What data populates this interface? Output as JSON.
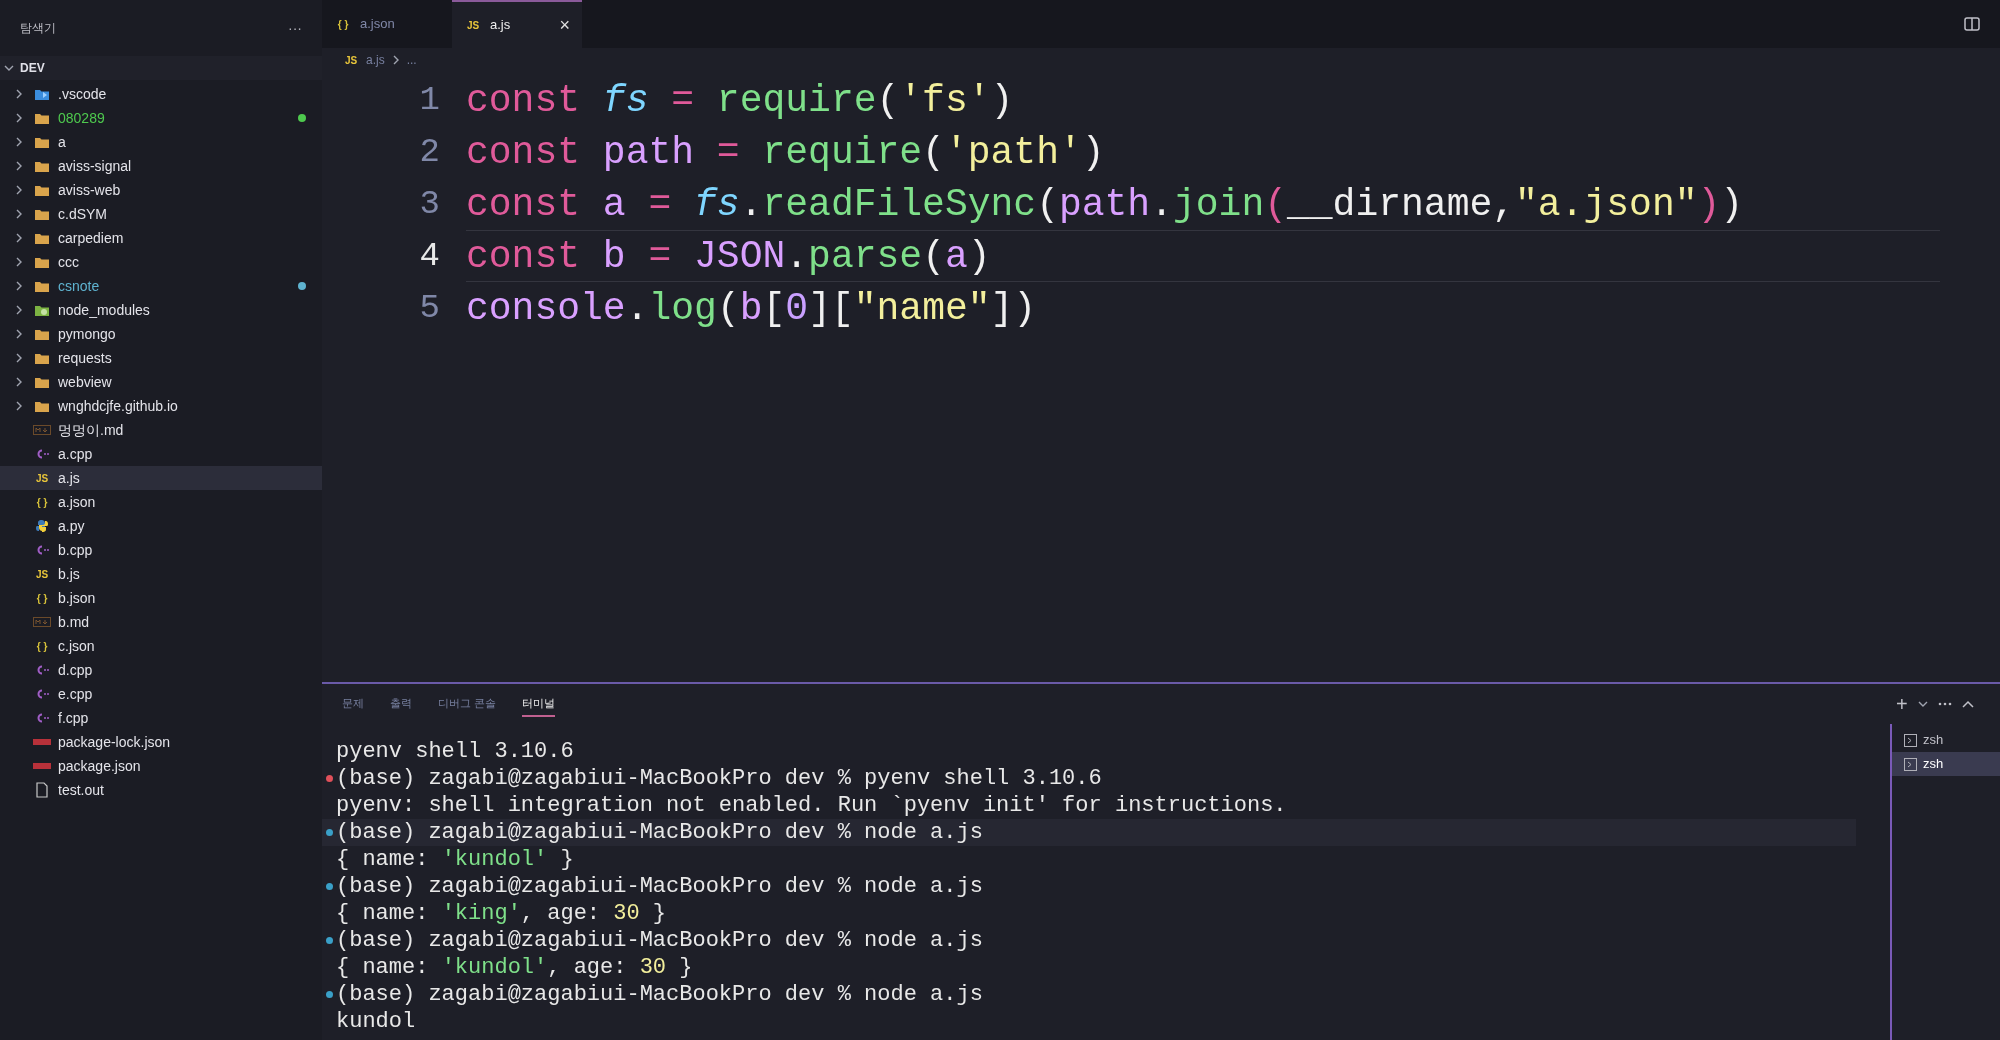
{
  "sidebar": {
    "title": "탐색기",
    "more": "···",
    "root": "DEV",
    "items": [
      {
        "name": ".vscode",
        "kind": "configfolder"
      },
      {
        "name": "080289",
        "kind": "folder",
        "color": "#4ec94e"
      },
      {
        "name": "a",
        "kind": "folder"
      },
      {
        "name": "aviss-signal",
        "kind": "folder"
      },
      {
        "name": "aviss-web",
        "kind": "folder"
      },
      {
        "name": "c.dSYM",
        "kind": "folder"
      },
      {
        "name": "carpediem",
        "kind": "folder"
      },
      {
        "name": "ccc",
        "kind": "folder"
      },
      {
        "name": "csnote",
        "kind": "folder",
        "color": "#5fb3d0"
      },
      {
        "name": "node_modules",
        "kind": "nodefolder"
      },
      {
        "name": "pymongo",
        "kind": "folder"
      },
      {
        "name": "requests",
        "kind": "folder"
      },
      {
        "name": "webview",
        "kind": "folder"
      },
      {
        "name": "wnghdcjfe.github.io",
        "kind": "folder"
      },
      {
        "name": "멍멍이.md",
        "kind": "markdown"
      },
      {
        "name": "a.cpp",
        "kind": "cpp"
      },
      {
        "name": "a.js",
        "kind": "js",
        "badge": "JS",
        "selected": true
      },
      {
        "name": "a.json",
        "kind": "json",
        "badge": "{ }"
      },
      {
        "name": "a.py",
        "kind": "python"
      },
      {
        "name": "b.cpp",
        "kind": "cpp"
      },
      {
        "name": "b.js",
        "kind": "js",
        "badge": "JS"
      },
      {
        "name": "b.json",
        "kind": "json",
        "badge": "{ }"
      },
      {
        "name": "b.md",
        "kind": "markdown"
      },
      {
        "name": "c.json",
        "kind": "json",
        "badge": "{ }"
      },
      {
        "name": "d.cpp",
        "kind": "cpp"
      },
      {
        "name": "e.cpp",
        "kind": "cpp"
      },
      {
        "name": "f.cpp",
        "kind": "cpp"
      },
      {
        "name": "package-lock.json",
        "kind": "npm"
      },
      {
        "name": "package.json",
        "kind": "npm"
      },
      {
        "name": "test.out",
        "kind": "text"
      }
    ]
  },
  "tabs": [
    {
      "label": "a.json",
      "kind": "json",
      "badge": "{ }",
      "selected": false
    },
    {
      "label": "a.js",
      "kind": "js",
      "badge": "JS",
      "selected": true,
      "close": "×"
    }
  ],
  "breadcrumb": {
    "badge": "JS",
    "file": "a.js",
    "rest": "..."
  },
  "editor": {
    "lines": [
      {
        "number": "1",
        "current": false,
        "tokens": [
          {
            "kind": "keyword",
            "text": "const "
          },
          {
            "kind": "module",
            "text": "fs"
          },
          {
            "kind": "operator",
            "text": " = "
          },
          {
            "kind": "function",
            "text": "require"
          },
          {
            "kind": "punct",
            "text": "("
          },
          {
            "kind": "string",
            "text": "'fs'"
          },
          {
            "kind": "punct",
            "text": ")"
          }
        ]
      },
      {
        "number": "2",
        "current": false,
        "tokens": [
          {
            "kind": "keyword",
            "text": "const "
          },
          {
            "kind": "variable",
            "text": "path"
          },
          {
            "kind": "operator",
            "text": " = "
          },
          {
            "kind": "function",
            "text": "require"
          },
          {
            "kind": "punct",
            "text": "("
          },
          {
            "kind": "string",
            "text": "'path'"
          },
          {
            "kind": "punct",
            "text": ")"
          }
        ]
      },
      {
        "number": "3",
        "current": false,
        "tokens": [
          {
            "kind": "keyword",
            "text": "const "
          },
          {
            "kind": "variable",
            "text": "a"
          },
          {
            "kind": "operator",
            "text": " = "
          },
          {
            "kind": "module",
            "text": "fs"
          },
          {
            "kind": "punct",
            "text": "."
          },
          {
            "kind": "function",
            "text": "readFileSync"
          },
          {
            "kind": "punct",
            "text": "("
          },
          {
            "kind": "variable",
            "text": "path"
          },
          {
            "kind": "punct",
            "text": "."
          },
          {
            "kind": "function",
            "text": "join"
          },
          {
            "kind": "bracket",
            "text": "("
          },
          {
            "kind": "punct",
            "text": "__dirname,"
          },
          {
            "kind": "string",
            "text": "\"a.json\""
          },
          {
            "kind": "bracket",
            "text": ")"
          },
          {
            "kind": "punct",
            "text": ")"
          }
        ]
      },
      {
        "number": "4",
        "current": true,
        "tokens": [
          {
            "kind": "keyword",
            "text": "const "
          },
          {
            "kind": "variable",
            "text": "b"
          },
          {
            "kind": "operator",
            "text": " = "
          },
          {
            "kind": "variable",
            "text": "JSON"
          },
          {
            "kind": "punct",
            "text": "."
          },
          {
            "kind": "function",
            "text": "parse"
          },
          {
            "kind": "punct",
            "text": "("
          },
          {
            "kind": "variable",
            "text": "a"
          },
          {
            "kind": "punct",
            "text": ")"
          }
        ]
      },
      {
        "number": "5",
        "current": false,
        "tokens": [
          {
            "kind": "variable",
            "text": "console"
          },
          {
            "kind": "punct",
            "text": "."
          },
          {
            "kind": "function",
            "text": "log"
          },
          {
            "kind": "punct",
            "text": "("
          },
          {
            "kind": "variable",
            "text": "b"
          },
          {
            "kind": "punct",
            "text": "["
          },
          {
            "kind": "number",
            "text": "0"
          },
          {
            "kind": "punct",
            "text": "]["
          },
          {
            "kind": "string",
            "text": "\"name\""
          },
          {
            "kind": "punct",
            "text": "])"
          }
        ]
      }
    ]
  },
  "panel": {
    "tabs": [
      {
        "label": "문제",
        "selected": false
      },
      {
        "label": "출력",
        "selected": false
      },
      {
        "label": "디버그 콘솔",
        "selected": false
      },
      {
        "label": "터미널",
        "selected": true
      }
    ],
    "new_terminal": "+",
    "terminal": [
      {
        "kind": "output",
        "tokens": [
          {
            "kind": "plain",
            "text": "pyenv shell 3.10.6"
          }
        ]
      },
      {
        "kind": "failed",
        "tokens": [
          {
            "kind": "plain",
            "text": "(base) zagabi@zagabiui-MacBookPro dev % pyenv shell 3.10.6"
          }
        ]
      },
      {
        "kind": "output",
        "tokens": [
          {
            "kind": "plain",
            "text": "pyenv: shell integration not enabled. Run `pyenv init' for instructions."
          }
        ]
      },
      {
        "kind": "succeeded",
        "tokens": [
          {
            "kind": "plain",
            "text": "(base) zagabi@zagabiui-MacBookPro dev % node a.js"
          }
        ]
      },
      {
        "kind": "output",
        "tokens": [
          {
            "kind": "plain",
            "text": "{ name: "
          },
          {
            "kind": "string",
            "text": "'kundol'"
          },
          {
            "kind": "plain",
            "text": " }"
          }
        ]
      },
      {
        "kind": "succeeded",
        "tokens": [
          {
            "kind": "plain",
            "text": "(base) zagabi@zagabiui-MacBookPro dev % node a.js"
          }
        ]
      },
      {
        "kind": "output",
        "tokens": [
          {
            "kind": "plain",
            "text": "{ name: "
          },
          {
            "kind": "string",
            "text": "'king'"
          },
          {
            "kind": "plain",
            "text": ", age: "
          },
          {
            "kind": "number",
            "text": "30"
          },
          {
            "kind": "plain",
            "text": " }"
          }
        ]
      },
      {
        "kind": "succeeded",
        "tokens": [
          {
            "kind": "plain",
            "text": "(base) zagabi@zagabiui-MacBookPro dev % node a.js"
          }
        ]
      },
      {
        "kind": "output",
        "tokens": [
          {
            "kind": "plain",
            "text": "{ name: "
          },
          {
            "kind": "string",
            "text": "'kundol'"
          },
          {
            "kind": "plain",
            "text": ", age: "
          },
          {
            "kind": "number",
            "text": "30"
          },
          {
            "kind": "plain",
            "text": " }"
          }
        ]
      },
      {
        "kind": "succeeded",
        "tokens": [
          {
            "kind": "plain",
            "text": "(base) zagabi@zagabiui-MacBookPro dev % node a.js"
          }
        ]
      },
      {
        "kind": "output",
        "tokens": [
          {
            "kind": "plain",
            "text": "kundol"
          }
        ]
      }
    ],
    "shells": [
      {
        "label": "zsh",
        "selected": false
      },
      {
        "label": "zsh",
        "selected": true
      }
    ]
  }
}
